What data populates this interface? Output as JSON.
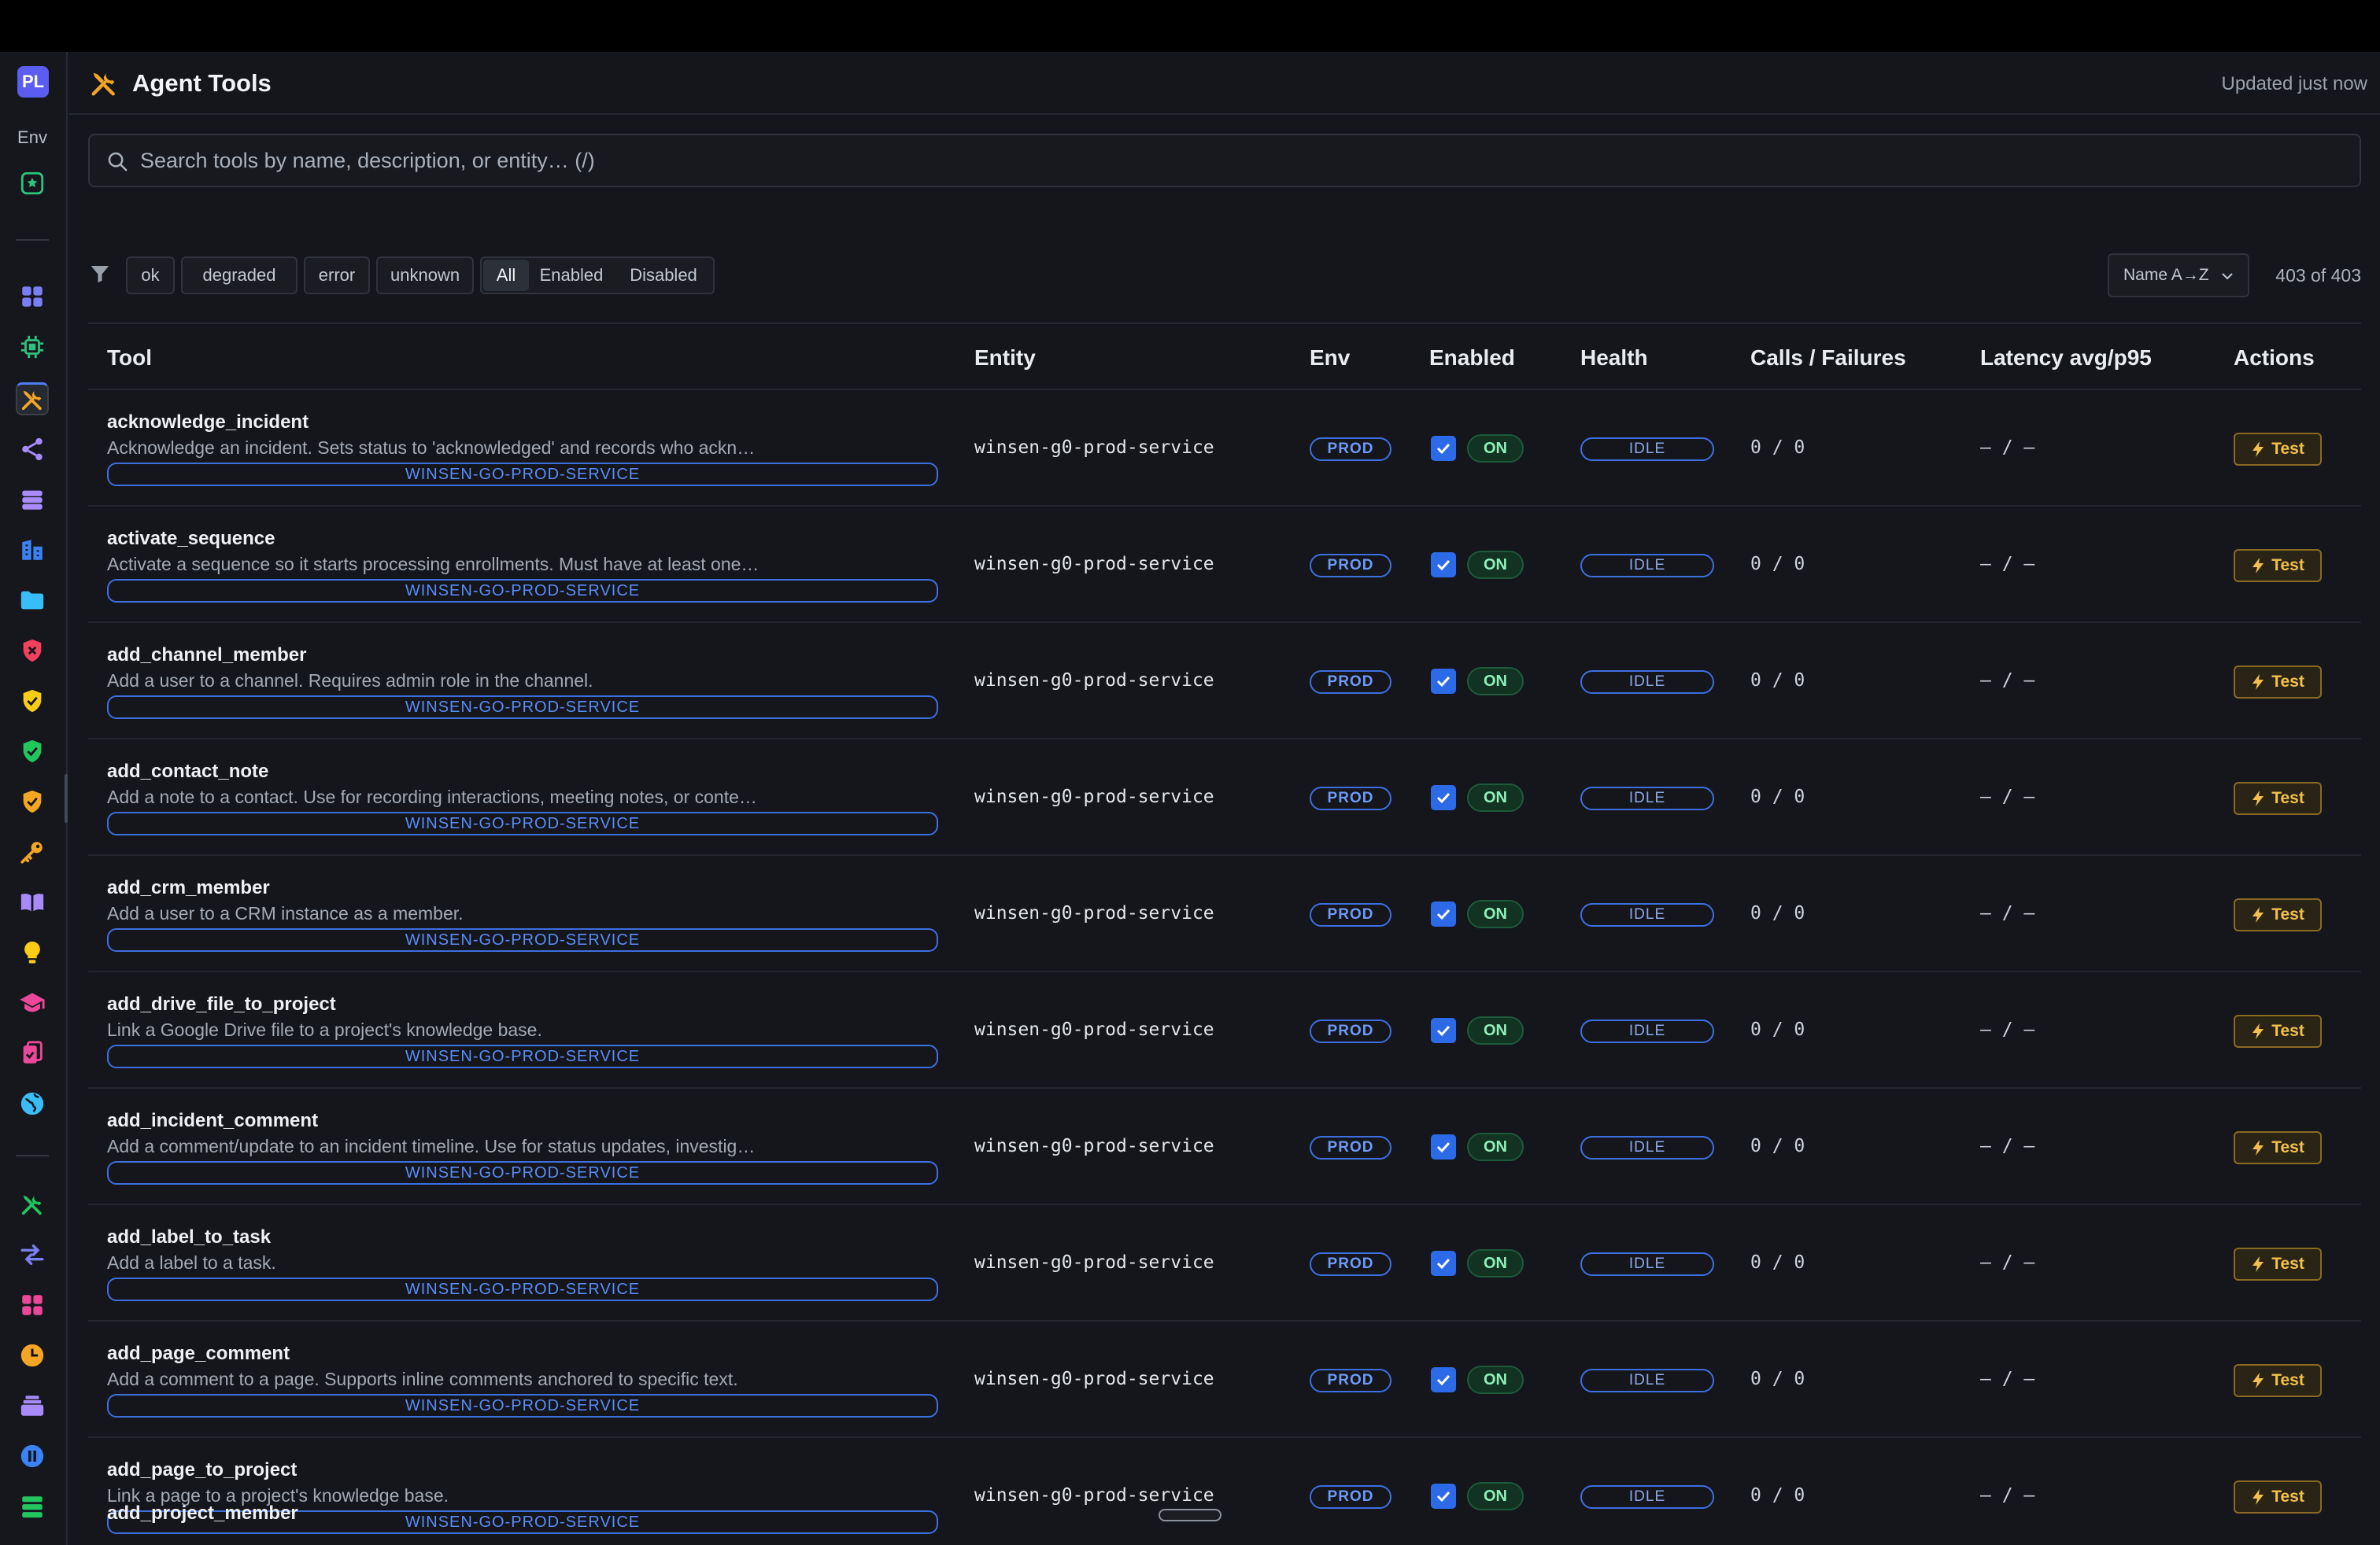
{
  "app": {
    "logo_text": "PL",
    "env_label": "Env"
  },
  "header": {
    "title": "Agent Tools",
    "icon": "tools-icon",
    "updated": "Updated just now"
  },
  "search": {
    "placeholder": "Search tools by name, description, or entity… (/)",
    "value": ""
  },
  "filters": {
    "health": [
      "ok",
      "degraded",
      "error",
      "unknown"
    ],
    "state": [
      "All",
      "Enabled",
      "Disabled"
    ],
    "active_state": "All",
    "sort_label": "Name A→Z",
    "count": "403 of 403"
  },
  "table": {
    "headers": {
      "tool": "Tool",
      "entity": "Entity",
      "env": "Env",
      "enabled": "Enabled",
      "health": "Health",
      "calls": "Calls / Failures",
      "latency": "Latency avg/p95",
      "actions": "Actions"
    },
    "rows": [
      {
        "name": "acknowledge_incident",
        "desc": "Acknowledge an incident. Sets status to 'acknowledged' and records who ackn…",
        "tag": "WINSEN-GO-PROD-SERVICE",
        "entity": "winsen-g0-prod-service",
        "env": "PROD",
        "enabled": "ON",
        "health": "IDLE",
        "calls": "0 / 0",
        "latency": "– / –",
        "action": "Test"
      },
      {
        "name": "activate_sequence",
        "desc": "Activate a sequence so it starts processing enrollments. Must have at least one…",
        "tag": "WINSEN-GO-PROD-SERVICE",
        "entity": "winsen-g0-prod-service",
        "env": "PROD",
        "enabled": "ON",
        "health": "IDLE",
        "calls": "0 / 0",
        "latency": "– / –",
        "action": "Test"
      },
      {
        "name": "add_channel_member",
        "desc": "Add a user to a channel. Requires admin role in the channel.",
        "tag": "WINSEN-GO-PROD-SERVICE",
        "entity": "winsen-g0-prod-service",
        "env": "PROD",
        "enabled": "ON",
        "health": "IDLE",
        "calls": "0 / 0",
        "latency": "– / –",
        "action": "Test"
      },
      {
        "name": "add_contact_note",
        "desc": "Add a note to a contact. Use for recording interactions, meeting notes, or conte…",
        "tag": "WINSEN-GO-PROD-SERVICE",
        "entity": "winsen-g0-prod-service",
        "env": "PROD",
        "enabled": "ON",
        "health": "IDLE",
        "calls": "0 / 0",
        "latency": "– / –",
        "action": "Test"
      },
      {
        "name": "add_crm_member",
        "desc": "Add a user to a CRM instance as a member.",
        "tag": "WINSEN-GO-PROD-SERVICE",
        "entity": "winsen-g0-prod-service",
        "env": "PROD",
        "enabled": "ON",
        "health": "IDLE",
        "calls": "0 / 0",
        "latency": "– / –",
        "action": "Test"
      },
      {
        "name": "add_drive_file_to_project",
        "desc": "Link a Google Drive file to a project's knowledge base.",
        "tag": "WINSEN-GO-PROD-SERVICE",
        "entity": "winsen-g0-prod-service",
        "env": "PROD",
        "enabled": "ON",
        "health": "IDLE",
        "calls": "0 / 0",
        "latency": "– / –",
        "action": "Test"
      },
      {
        "name": "add_incident_comment",
        "desc": "Add a comment/update to an incident timeline. Use for status updates, investig…",
        "tag": "WINSEN-GO-PROD-SERVICE",
        "entity": "winsen-g0-prod-service",
        "env": "PROD",
        "enabled": "ON",
        "health": "IDLE",
        "calls": "0 / 0",
        "latency": "– / –",
        "action": "Test"
      },
      {
        "name": "add_label_to_task",
        "desc": "Add a label to a task.",
        "tag": "WINSEN-GO-PROD-SERVICE",
        "entity": "winsen-g0-prod-service",
        "env": "PROD",
        "enabled": "ON",
        "health": "IDLE",
        "calls": "0 / 0",
        "latency": "– / –",
        "action": "Test"
      },
      {
        "name": "add_page_comment",
        "desc": "Add a comment to a page. Supports inline comments anchored to specific text.",
        "tag": "WINSEN-GO-PROD-SERVICE",
        "entity": "winsen-g0-prod-service",
        "env": "PROD",
        "enabled": "ON",
        "health": "IDLE",
        "calls": "0 / 0",
        "latency": "– / –",
        "action": "Test"
      },
      {
        "name": "add_page_to_project",
        "desc": "Link a page to a project's knowledge base.",
        "tag": "WINSEN-GO-PROD-SERVICE",
        "entity": "winsen-g0-prod-service",
        "env": "PROD",
        "enabled": "ON",
        "health": "IDLE",
        "calls": "0 / 0",
        "latency": "– / –",
        "action": "Test"
      }
    ],
    "partial_row_name": "add_project_member"
  },
  "sidebar": {
    "items": [
      {
        "name": "dashboard-grid-icon",
        "color": "#7b7ff5"
      },
      {
        "name": "chip-icon",
        "color": "#2ec27e"
      },
      {
        "name": "tools-icon",
        "color": "#f5a524",
        "active": true
      },
      {
        "name": "share-nodes-icon",
        "color": "#a78bfa"
      },
      {
        "name": "database-stack-icon",
        "color": "#a78bfa"
      },
      {
        "name": "building-icon",
        "color": "#3b82f6"
      },
      {
        "name": "folder-icon",
        "color": "#38bdf8"
      },
      {
        "name": "shield-red-icon",
        "color": "#f43f5e"
      },
      {
        "name": "shield-check-yellow-icon",
        "color": "#facc15"
      },
      {
        "name": "shield-check-green-icon",
        "color": "#22c55e"
      },
      {
        "name": "shield-check-amber-icon",
        "color": "#f5a524"
      },
      {
        "name": "key-icon",
        "color": "#f5a524"
      },
      {
        "name": "book-icon",
        "color": "#a78bfa"
      },
      {
        "name": "lightbulb-icon",
        "color": "#facc15"
      },
      {
        "name": "graduation-cap-icon",
        "color": "#ec4899"
      },
      {
        "name": "clipboard-check-icon",
        "color": "#ec4899"
      },
      {
        "name": "globe-icon",
        "color": "#38bdf8"
      },
      {
        "name": "wrench-screwdriver-icon",
        "color": "#22c55e"
      },
      {
        "name": "arrows-swap-icon",
        "color": "#7b7ff5"
      },
      {
        "name": "apps-grid-icon",
        "color": "#ec4899"
      },
      {
        "name": "clock-icon",
        "color": "#f5a524"
      },
      {
        "name": "inbox-stack-icon",
        "color": "#a78bfa"
      },
      {
        "name": "pause-circle-icon",
        "color": "#3b82f6"
      },
      {
        "name": "server-icon",
        "color": "#22c55e"
      }
    ]
  },
  "colors": {
    "background": "#14161b",
    "accent_blue": "#3d6fe0",
    "on_green": "#8ff0b8",
    "test_amber": "#f2c04b"
  }
}
